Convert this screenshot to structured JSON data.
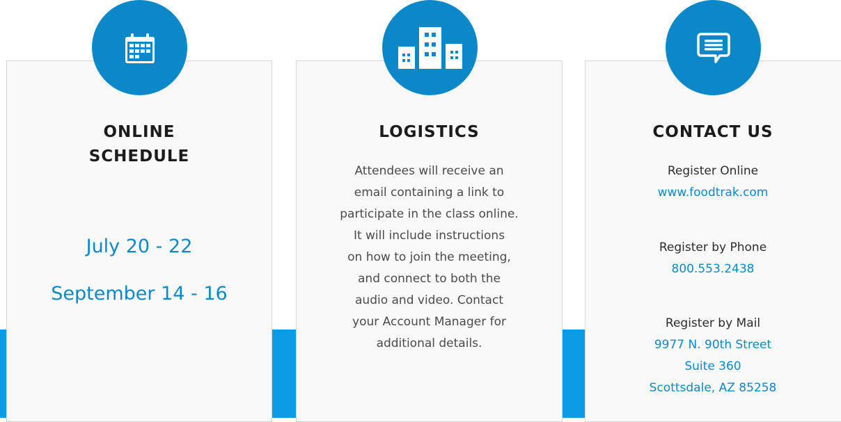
{
  "colors": {
    "accent": "#0b88c8",
    "band": "#0b9be3",
    "card_bg": "#f9f9f9"
  },
  "cards": [
    {
      "icon": "calendar-icon",
      "title_lines": [
        "ONLINE",
        "SCHEDULE"
      ],
      "dates": [
        "July 20 - 22",
        "September 14 - 16"
      ]
    },
    {
      "icon": "buildings-icon",
      "title": "LOGISTICS",
      "body_lines": [
        "Attendees will receive an",
        "email containing a link to",
        "participate in the class online.",
        "It will include instructions",
        "on how to join the meeting,",
        "and connect to both the",
        "audio and video. Contact",
        "your Account Manager for",
        "additional details."
      ]
    },
    {
      "icon": "chat-icon",
      "title": "CONTACT US",
      "online": {
        "label": "Register Online",
        "value": "www.foodtrak.com"
      },
      "phone": {
        "label": "Register by Phone",
        "value": "800.553.2438"
      },
      "mail": {
        "label": "Register by Mail",
        "lines": [
          "9977 N. 90th Street",
          "Suite 360",
          "Scottsdale, AZ 85258"
        ]
      }
    }
  ]
}
